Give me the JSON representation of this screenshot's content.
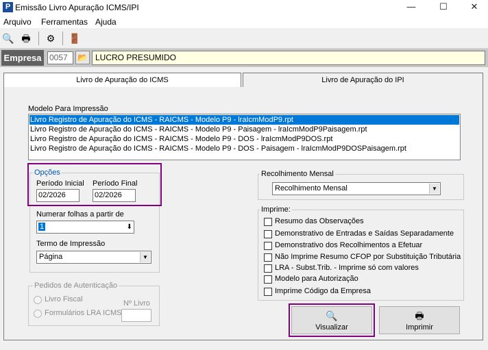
{
  "window": {
    "app_icon": "P",
    "title": "Emissão Livro Apuração ICMS/IPI",
    "minimize": "—",
    "maximize": "☐",
    "close": "✕"
  },
  "menu": [
    "Arquivo",
    "Ferramentas",
    "Ajuda"
  ],
  "toolbar": {
    "icons": [
      "preview-icon",
      "print-icon",
      "settings-icon",
      "exit-door-icon"
    ],
    "glyphs": [
      "🔍",
      "🖶",
      "⚙",
      "🚪"
    ]
  },
  "empresa": {
    "label": "Empresa",
    "code": "0057",
    "folder_glyph": "📂",
    "name": "LUCRO PRESUMIDO"
  },
  "tabs": [
    {
      "label": "Livro de Apuração do ICMS",
      "active": true
    },
    {
      "label": "Livro de Apuração do IPI",
      "active": false
    }
  ],
  "modelo": {
    "label": "Modelo Para Impressão",
    "items": [
      {
        "text": "Livro Registro de Apuração do ICMS - RAICMS - Modelo P9 - lraIcmModP9.rpt",
        "selected": true
      },
      {
        "text": "Livro Registro de Apuração do ICMS - RAICMS - Modelo P9 - Paisagem - lraIcmModP9Paisagem.rpt",
        "selected": false
      },
      {
        "text": "Livro Registro de Apuração do ICMS - RAICMS - Modelo P9 - DOS - lraIcmModP9DOS.rpt",
        "selected": false
      },
      {
        "text": "Livro Registro de Apuração do ICMS - RAICMS - Modelo P9 - DOS - Paisagem - lraIcmModP9DOSPaisagem.rpt",
        "selected": false
      }
    ]
  },
  "opcoes": {
    "title": "Opções",
    "periodo_inicial_label": "Período Inicial",
    "periodo_inicial": "02/2026",
    "periodo_final_label": "Período Final",
    "periodo_final": "02/2026",
    "numerar_label": "Numerar folhas a partir de",
    "numerar_value": "1",
    "termo_label": "Termo de Impressão",
    "termo_value": "Página"
  },
  "pedidos": {
    "title": "Pedidos de Autenticação",
    "livro_fiscal": "Livro Fiscal",
    "formularios": "Formulários LRA ICMS",
    "n_livro_label": "Nº Livro",
    "n_livro_value": ""
  },
  "recolhimento": {
    "title": "Recolhimento Mensal",
    "value": "Recolhimento Mensal"
  },
  "imprime": {
    "title": "Imprime:",
    "options": [
      {
        "label": "Resumo das Observações",
        "checked": false
      },
      {
        "label": "Demonstrativo de Entradas e Saídas Separadamente",
        "checked": false
      },
      {
        "label": "Demonstrativo dos Recolhimentos a Efetuar",
        "checked": false
      },
      {
        "label": "Não Imprime Resumo CFOP por Substituição Tributária",
        "checked": false
      },
      {
        "label": "LRA - Subst.Trib. - Imprime só com valores",
        "checked": false
      },
      {
        "label": "Modelo para Autorização",
        "checked": false
      },
      {
        "label": "Imprime Código da Empresa",
        "checked": false
      }
    ]
  },
  "buttons": {
    "visualizar": "Visualizar",
    "visualizar_glyph": "🔍",
    "imprimir": "Imprimir",
    "imprimir_glyph": "🖶"
  },
  "colors": {
    "highlight": "#800080",
    "selection": "#0078d7",
    "empresa_label_bg": "#606060",
    "empresa_name_bg": "#ffffe1"
  }
}
